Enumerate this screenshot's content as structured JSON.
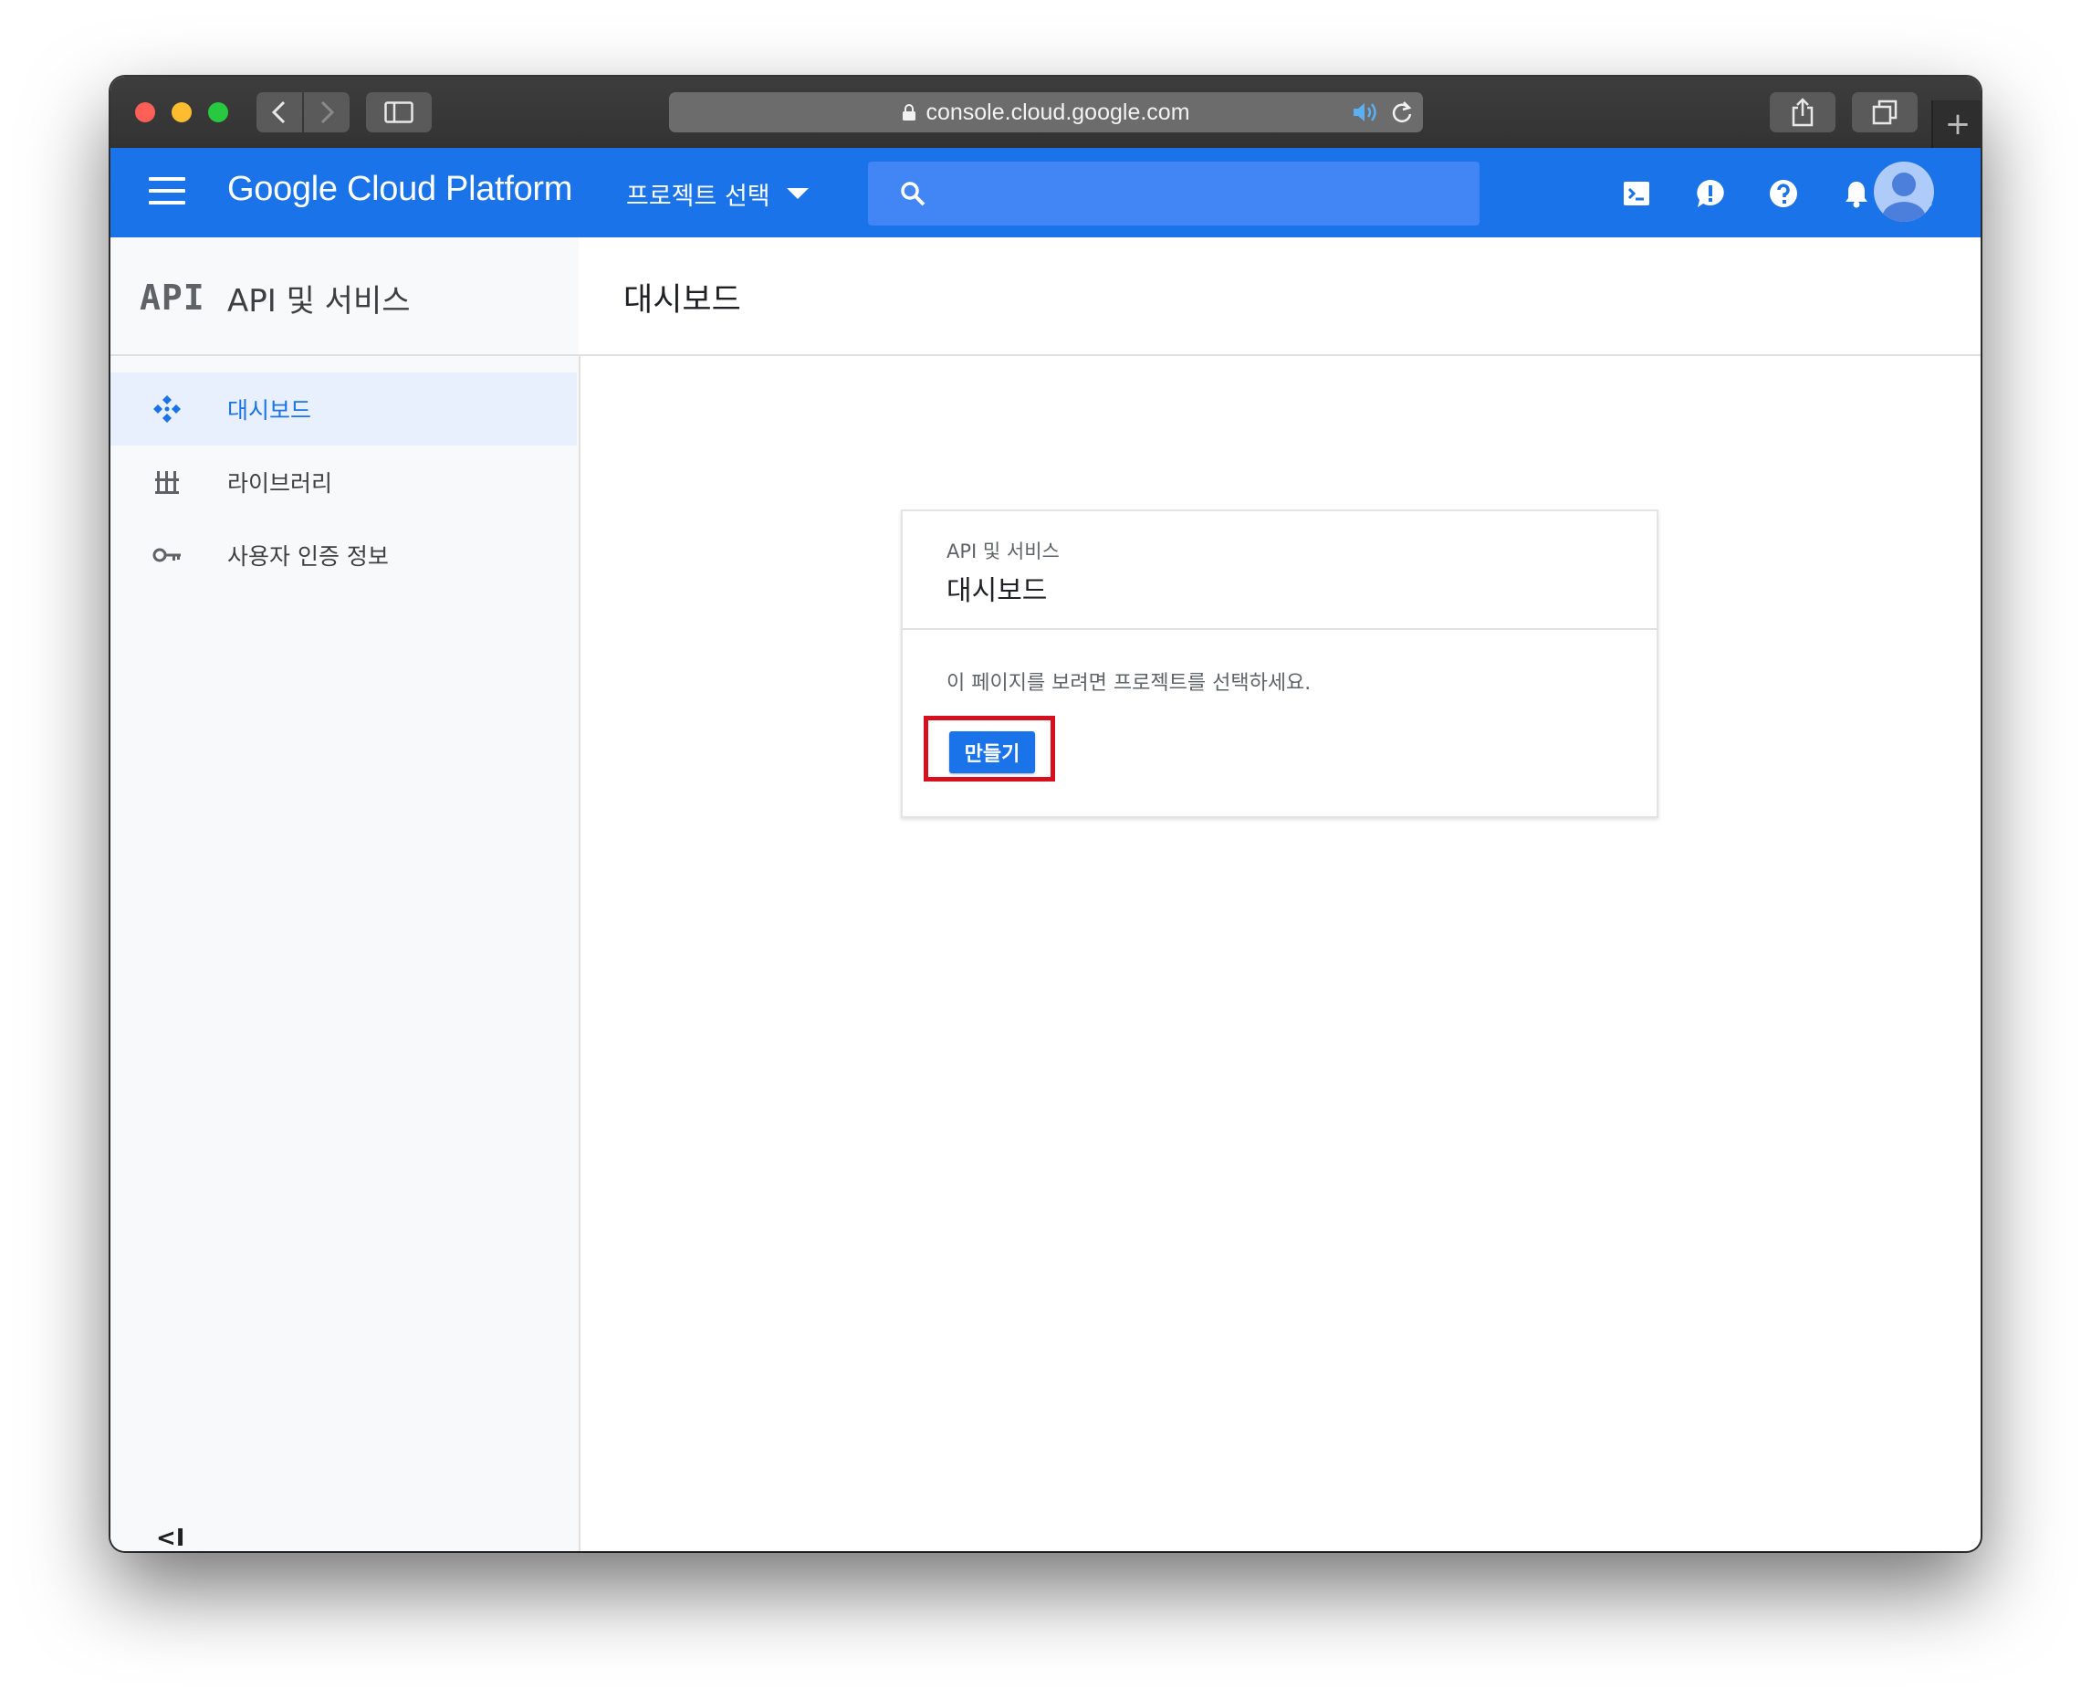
{
  "browser": {
    "url": "console.cloud.google.com",
    "new_tab_glyph": "+"
  },
  "header": {
    "brand": "Google Cloud Platform",
    "project_select_label": "프로젝트 선택",
    "icons": [
      "menu-icon",
      "search-icon",
      "cloud-shell-icon",
      "feedback-icon",
      "help-icon",
      "notifications-icon",
      "more-vert-icon",
      "avatar"
    ],
    "accent_color": "#1a73e8"
  },
  "sidebar": {
    "logo_text": "API",
    "title": "API 및 서비스",
    "items": [
      {
        "label": "대시보드",
        "icon": "dashboard-icon",
        "active": true
      },
      {
        "label": "라이브러리",
        "icon": "library-icon",
        "active": false
      },
      {
        "label": "사용자 인증 정보",
        "icon": "key-icon",
        "active": false
      }
    ],
    "collapse_glyph": "<I"
  },
  "main": {
    "title": "대시보드",
    "card": {
      "subtitle": "API 및 서비스",
      "title": "대시보드",
      "message": "이 페이지를 보려면 프로젝트를 선택하세요.",
      "create_button": "만들기",
      "highlight_color": "#d50f1e"
    }
  }
}
